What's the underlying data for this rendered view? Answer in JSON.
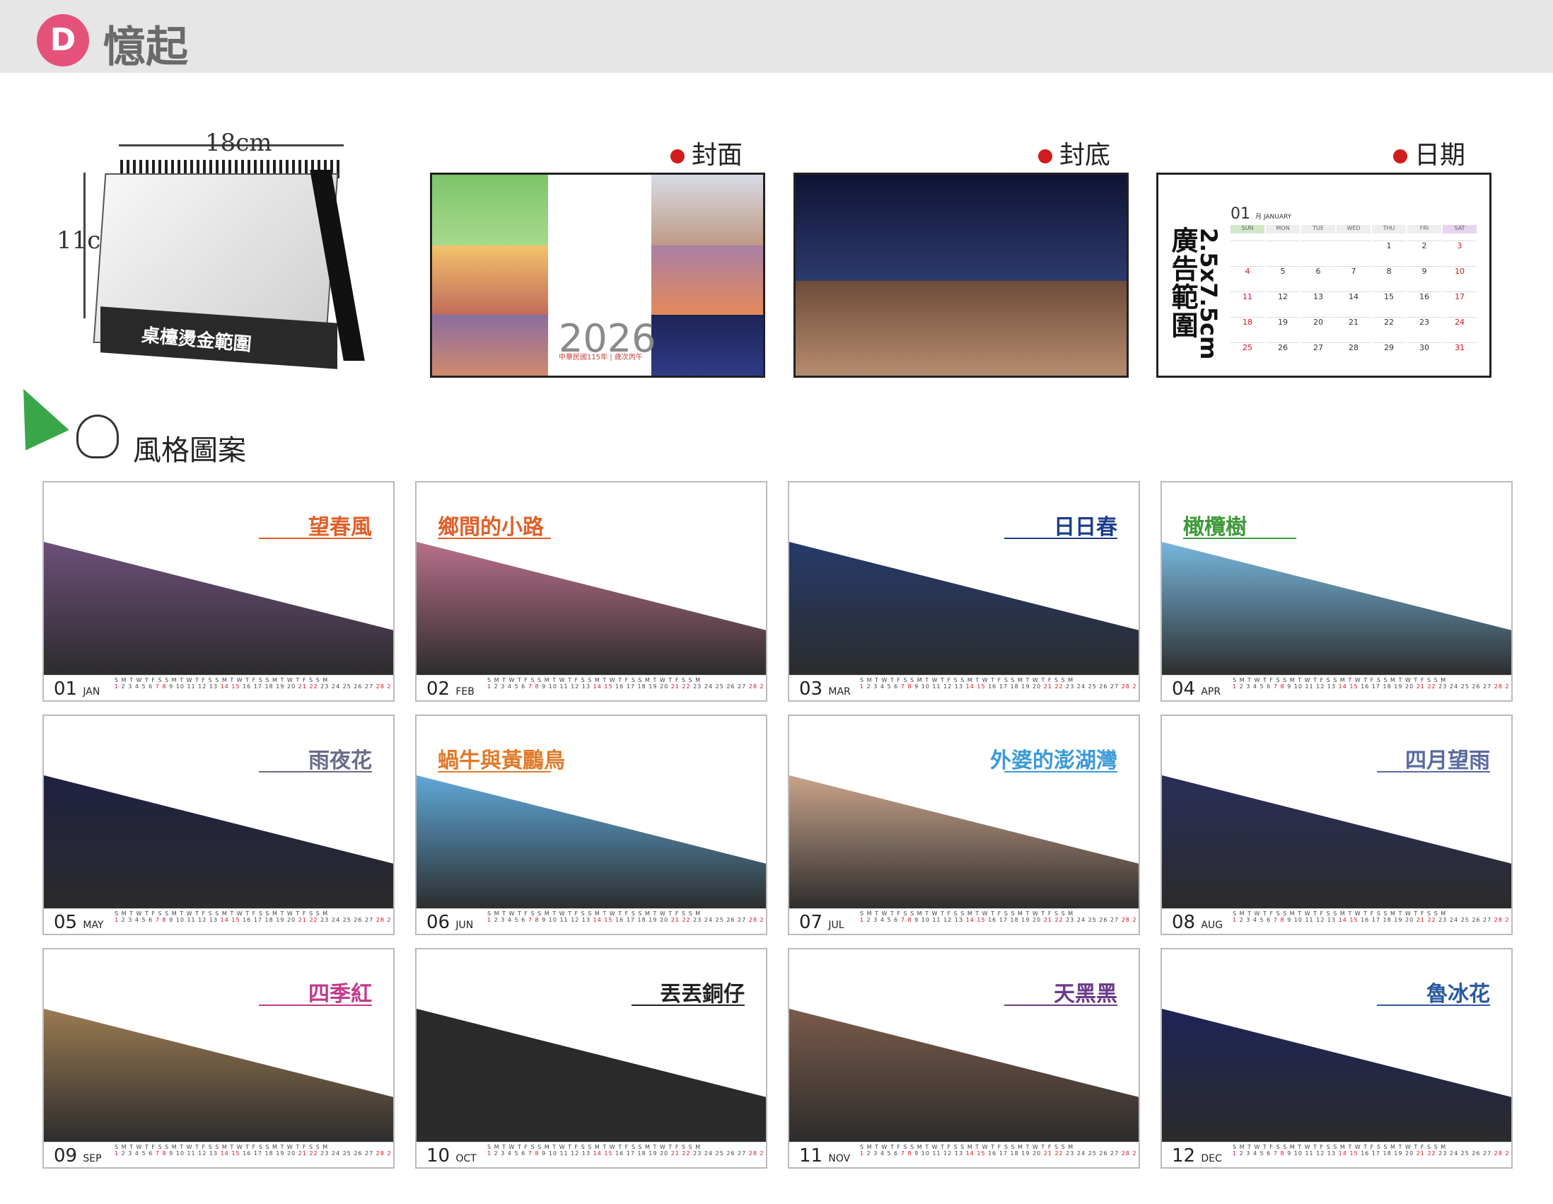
{
  "header": {
    "badge": "D",
    "title": "憶起"
  },
  "desk": {
    "width_label": "18cm",
    "height_label": "11cm",
    "base_label": "桌檯燙金範圍"
  },
  "sections": {
    "cover": "封面",
    "back": "封底",
    "date": "日期",
    "style": "風格圖案"
  },
  "cover": {
    "year": "2026",
    "subtitle": "中華民國115年 | 歲次丙午"
  },
  "date_block": {
    "ad_text": "廣告範圍",
    "ad_size": "2.5x7.5cm",
    "month_num": "01",
    "month_name": "月 JANUARY",
    "weekdays": [
      "SUN",
      "MON",
      "TUE",
      "WED",
      "THU",
      "FRI",
      "SAT"
    ],
    "weeks": [
      [
        "",
        "",
        "",
        "",
        "1",
        "2",
        "3"
      ],
      [
        "4",
        "5",
        "6",
        "7",
        "8",
        "9",
        "10"
      ],
      [
        "11",
        "12",
        "13",
        "14",
        "15",
        "16",
        "17"
      ],
      [
        "18",
        "19",
        "20",
        "21",
        "22",
        "23",
        "24"
      ],
      [
        "25",
        "26",
        "27",
        "28",
        "29",
        "30",
        "31"
      ]
    ]
  },
  "months": [
    {
      "num": "01",
      "abbr": "JAN",
      "title": "望春風",
      "color": "#e0602a",
      "art": "#6d4f7a"
    },
    {
      "num": "02",
      "abbr": "FEB",
      "title": "鄉間的小路",
      "color": "#e0602a",
      "art": "#b86f8a"
    },
    {
      "num": "03",
      "abbr": "MAR",
      "title": "日日春",
      "color": "#1d3e8c",
      "art": "#263b6b"
    },
    {
      "num": "04",
      "abbr": "APR",
      "title": "橄欖樹",
      "color": "#3f9a3a",
      "art": "#77b7dd"
    },
    {
      "num": "05",
      "abbr": "MAY",
      "title": "雨夜花",
      "color": "#6b6b8a",
      "art": "#1f2142"
    },
    {
      "num": "06",
      "abbr": "JUN",
      "title": "蝸牛與黃鸝鳥",
      "color": "#e07a2a",
      "art": "#5fa8d8"
    },
    {
      "num": "07",
      "abbr": "JUL",
      "title": "外婆的澎湖灣",
      "color": "#3b9ad8",
      "art": "#c9a38a"
    },
    {
      "num": "08",
      "abbr": "AUG",
      "title": "四月望雨",
      "color": "#5a6aa0",
      "art": "#2a2e58"
    },
    {
      "num": "09",
      "abbr": "SEP",
      "title": "四季紅",
      "color": "#c23a8a",
      "art": "#9a7a52"
    },
    {
      "num": "10",
      "abbr": "OCT",
      "title": "丟丟銅仔",
      "color": "#222222",
      "art": "#2a2a2a"
    },
    {
      "num": "11",
      "abbr": "NOV",
      "title": "天黑黑",
      "color": "#6b3a8a",
      "art": "#7a5a4a"
    },
    {
      "num": "12",
      "abbr": "DEC",
      "title": "魯冰花",
      "color": "#2a5aa0",
      "art": "#1e2456"
    }
  ]
}
